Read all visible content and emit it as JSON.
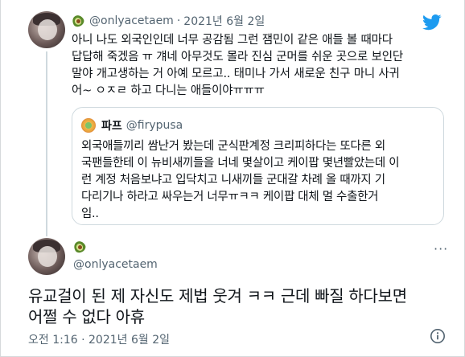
{
  "reply_tweet": {
    "handle": "@onlyacetaem",
    "separator": "·",
    "date": "2021년 6월 2일",
    "text_lines": [
      "아니 나도 외국인인데 너무 공감됨 그런 잼민이 같은 애들 볼 때마다",
      "답답해 죽겠음 ㅠ 걔네 아무것도 몰라 진심 군머를 쉬운 곳으로 보인단",
      "말야 개고생하는 거 아예 모르고.. 태미나 가서 새로운 친구 마니 사귀",
      "어~ ㅇㅈㄹ 하고 다니는 애들이야ㅠㅠㅠ"
    ]
  },
  "quoted_tweet": {
    "name": "파프",
    "handle": "@firypusa",
    "text_lines": [
      "외국애들끼리 쌈난거 봤는데 군식판계정 크리피하다는 또다른 외",
      "국팬들한테 이 뉴비새끼들을 너네 몇살이고 케이팝 몇년빨았는데 이",
      "런 계정 처음보냐고 입닥치고 니새끼들 군대갈 차례 올 때까지 기",
      "다리기나 하라고 싸우는거 너무ㅠㅋㅋ 케이팝 대체 멀 수출한거",
      "임.."
    ]
  },
  "main_tweet": {
    "handle": "@onlyacetaem",
    "text_lines": [
      "유교걸이 된 제 자신도 제법 웃겨 ㅋㅋ 근데 빠질 하다보면",
      "어쩔 수 없다 아휴"
    ],
    "timestamp": "오전 1:16 · 2021년 6월 2일"
  },
  "icons": {
    "brand": "twitter-bird-icon",
    "more": "more-icon",
    "info": "info-icon",
    "name_emoji": "avocado-icon"
  },
  "colors": {
    "accent": "#1d9bf0",
    "text": "#0f1419",
    "secondary": "#536471",
    "border": "#cfd9de"
  }
}
